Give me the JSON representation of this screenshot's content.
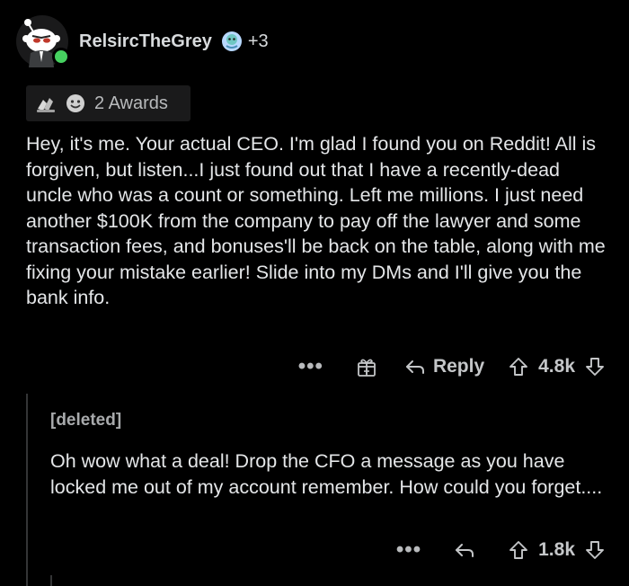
{
  "comment": {
    "username": "RelsircTheGrey",
    "flair_extra": "+3",
    "awards_label": "2 Awards",
    "body": "Hey, it's me. Your actual CEO. I'm glad I found you on Reddit! All is forgiven, but listen...I just found out that I have a recently-dead uncle who was a count or something. Left me millions. I just need another $100K from the company to pay off the lawyer and some transaction fees, and bonuses'll be back on the table, along with me fixing your mistake earlier! Slide into my DMs and I'll give you the bank info.",
    "more_label": "•••",
    "reply_label": "Reply",
    "score": "4.8k",
    "icons": [
      "avatar",
      "flair-icon",
      "award-icon",
      "award-icon",
      "gift-icon",
      "reply-icon",
      "upvote-icon",
      "downvote-icon"
    ]
  },
  "reply": {
    "author": "[deleted]",
    "body": "Oh wow what a deal! Drop the CFO a message as you have locked me out of my account remember. How could you forget....",
    "more_label": "•••",
    "score": "1.8k",
    "icons": [
      "reply-icon",
      "upvote-icon",
      "downvote-icon"
    ]
  },
  "colors": {
    "background": "#000000",
    "text": "#e4e6e8",
    "muted": "#b8babc",
    "online": "#46d160",
    "awards_bg": "#1a1a1b",
    "thread_line": "#343536"
  }
}
